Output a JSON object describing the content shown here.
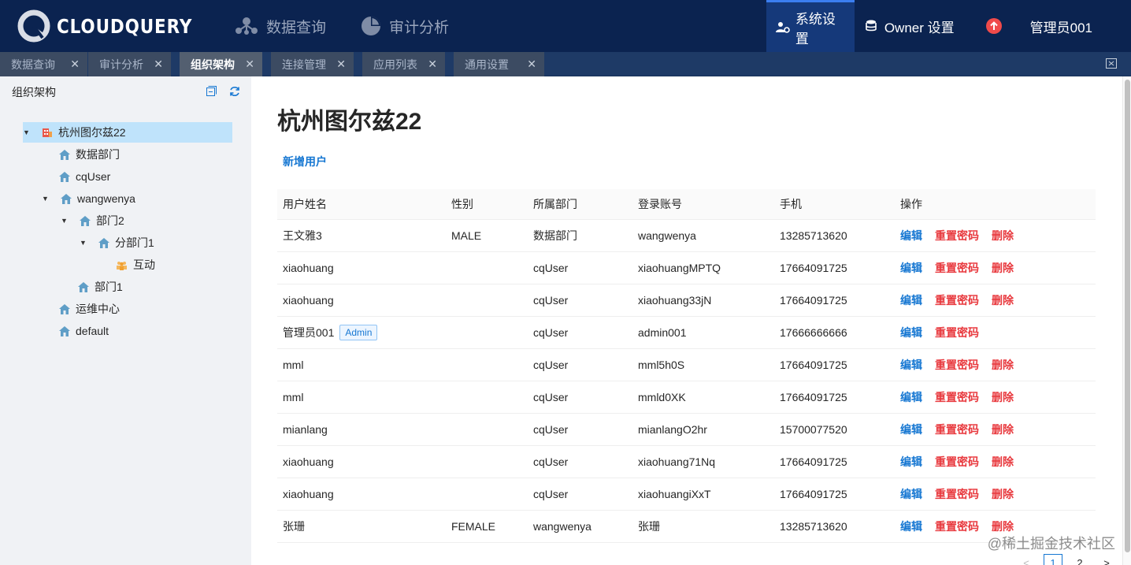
{
  "header": {
    "logo_text": "CLOUDQUERY",
    "nav": [
      {
        "label": "数据查询",
        "icon": "network-icon"
      },
      {
        "label": "审计分析",
        "icon": "pie-chart-icon"
      }
    ],
    "right": {
      "settings_label": "系统设置",
      "owner_label": "Owner 设置",
      "user_label": "管理员001"
    },
    "colors": {
      "bg": "#0b2350",
      "active_bg": "#15397a",
      "accent": "#3b7ef0"
    }
  },
  "tabs": [
    {
      "label": "数据查询",
      "active": false
    },
    {
      "label": "审计分析",
      "active": false
    },
    {
      "label": "组织架构",
      "active": true
    },
    {
      "label": "连接管理",
      "active": false
    },
    {
      "label": "应用列表",
      "active": false
    },
    {
      "label": "通用设置",
      "active": false
    }
  ],
  "sidebar": {
    "title": "组织架构",
    "tree": [
      {
        "label": "杭州图尔兹22",
        "icon": "building-icon",
        "expanded": true,
        "selected": true
      },
      {
        "label": "数据部门",
        "icon": "home-icon"
      },
      {
        "label": "cqUser",
        "icon": "home-icon"
      },
      {
        "label": "wangwenya",
        "icon": "home-icon",
        "expanded": true
      },
      {
        "label": "部门2",
        "icon": "home-icon",
        "expanded": true
      },
      {
        "label": "分部门1",
        "icon": "home-icon",
        "expanded": true
      },
      {
        "label": "互动",
        "icon": "team-icon"
      },
      {
        "label": "部门1",
        "icon": "home-icon"
      },
      {
        "label": "运维中心",
        "icon": "home-icon"
      },
      {
        "label": "default",
        "icon": "home-icon"
      }
    ]
  },
  "main": {
    "title": "杭州图尔兹22",
    "add_user_label": "新增用户",
    "columns": [
      "用户姓名",
      "性别",
      "所属部门",
      "登录账号",
      "手机",
      "操作"
    ],
    "actions": {
      "edit": "编辑",
      "reset": "重置密码",
      "delete": "删除"
    },
    "rows": [
      {
        "name": "王文雅3",
        "badge": "",
        "gender": "MALE",
        "dept": "数据部门",
        "account": "wangwenya",
        "phone": "13285713620",
        "can_delete": true
      },
      {
        "name": "xiaohuang",
        "badge": "",
        "gender": "",
        "dept": "cqUser",
        "account": "xiaohuangMPTQ",
        "phone": "17664091725",
        "can_delete": true
      },
      {
        "name": "xiaohuang",
        "badge": "",
        "gender": "",
        "dept": "cqUser",
        "account": "xiaohuang33jN",
        "phone": "17664091725",
        "can_delete": true
      },
      {
        "name": "管理员001",
        "badge": "Admin",
        "gender": "",
        "dept": "cqUser",
        "account": "admin001",
        "phone": "17666666666",
        "can_delete": false
      },
      {
        "name": "mml",
        "badge": "",
        "gender": "",
        "dept": "cqUser",
        "account": "mml5h0S",
        "phone": "17664091725",
        "can_delete": true
      },
      {
        "name": "mml",
        "badge": "",
        "gender": "",
        "dept": "cqUser",
        "account": "mmld0XK",
        "phone": "17664091725",
        "can_delete": true
      },
      {
        "name": "mianlang",
        "badge": "",
        "gender": "",
        "dept": "cqUser",
        "account": "mianlangO2hr",
        "phone": "15700077520",
        "can_delete": true
      },
      {
        "name": "xiaohuang",
        "badge": "",
        "gender": "",
        "dept": "cqUser",
        "account": "xiaohuang71Nq",
        "phone": "17664091725",
        "can_delete": true
      },
      {
        "name": "xiaohuang",
        "badge": "",
        "gender": "",
        "dept": "cqUser",
        "account": "xiaohuangiXxT",
        "phone": "17664091725",
        "can_delete": true
      },
      {
        "name": "张珊",
        "badge": "",
        "gender": "FEMALE",
        "dept": "wangwenya",
        "account": "张珊",
        "phone": "13285713620",
        "can_delete": true
      }
    ],
    "pagination": {
      "prev": "<",
      "current": "1",
      "next_page": "2",
      "next": ">"
    }
  },
  "watermark": "@稀土掘金技术社区"
}
